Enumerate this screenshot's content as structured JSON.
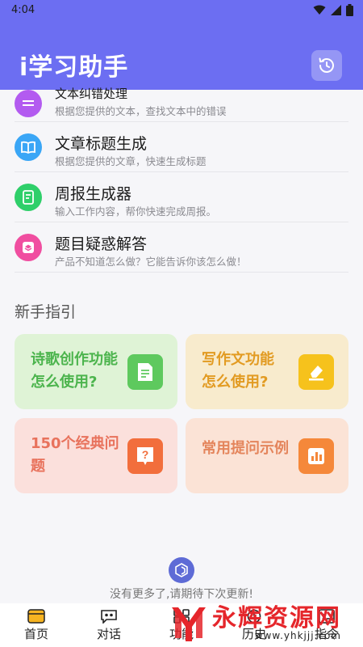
{
  "status_bar": {
    "time": "4:04"
  },
  "header": {
    "title": "i学习助手",
    "history_icon": "history-icon"
  },
  "list": [
    {
      "title": "文本纠错处理",
      "subtitle": "根据您提供的文本，查找文本中的错误",
      "icon": "text-correct-icon",
      "color": "#b35bf0"
    },
    {
      "title": "文章标题生成",
      "subtitle": "根据您提供的文章，快速生成标题",
      "icon": "book-icon",
      "color": "#3aa6f6"
    },
    {
      "title": "周报生成器",
      "subtitle": "输入工作内容，帮你快速完成周报。",
      "icon": "report-icon",
      "color": "#2fcf6a"
    },
    {
      "title": "题目疑惑解答",
      "subtitle": "产品不知道怎么做？它能告诉你该怎么做！",
      "icon": "cube-icon",
      "color": "#f04ea0"
    }
  ],
  "guide": {
    "title": "新手指引",
    "cards": [
      {
        "title_line1": "诗歌创作功能",
        "title_line2": "怎么使用?",
        "icon": "document-icon",
        "bg": "#dff3d6",
        "fg": "#4cb44d",
        "icon_bg": "#5ec95e"
      },
      {
        "title_line1": "写作文功能",
        "title_line2": "怎么使用?",
        "icon": "eraser-icon",
        "bg": "#f8ebcd",
        "fg": "#e29b22",
        "icon_bg": "#f6c21c"
      },
      {
        "title_line1": "150个经典问",
        "title_line2": "题",
        "icon": "question-icon",
        "bg": "#fbe0dc",
        "fg": "#e8725c",
        "icon_bg": "#f26e3c"
      },
      {
        "title_line1": "常用提问示例",
        "title_line2": "",
        "icon": "bar-chart-icon",
        "bg": "#fbe3d6",
        "fg": "#e4855c",
        "icon_bg": "#f5883a"
      }
    ]
  },
  "footer": {
    "text": "没有更多了,请期待下次更新!"
  },
  "tabs": [
    {
      "label": "首页",
      "icon": "home-icon"
    },
    {
      "label": "对话",
      "icon": "chat-icon"
    },
    {
      "label": "功能",
      "icon": "function-icon"
    },
    {
      "label": "历史",
      "icon": "history-tab-icon"
    },
    {
      "label": "指令",
      "icon": "command-icon"
    }
  ],
  "watermark": {
    "name": "永辉资源网",
    "url": "www.yhkjjj.com"
  }
}
